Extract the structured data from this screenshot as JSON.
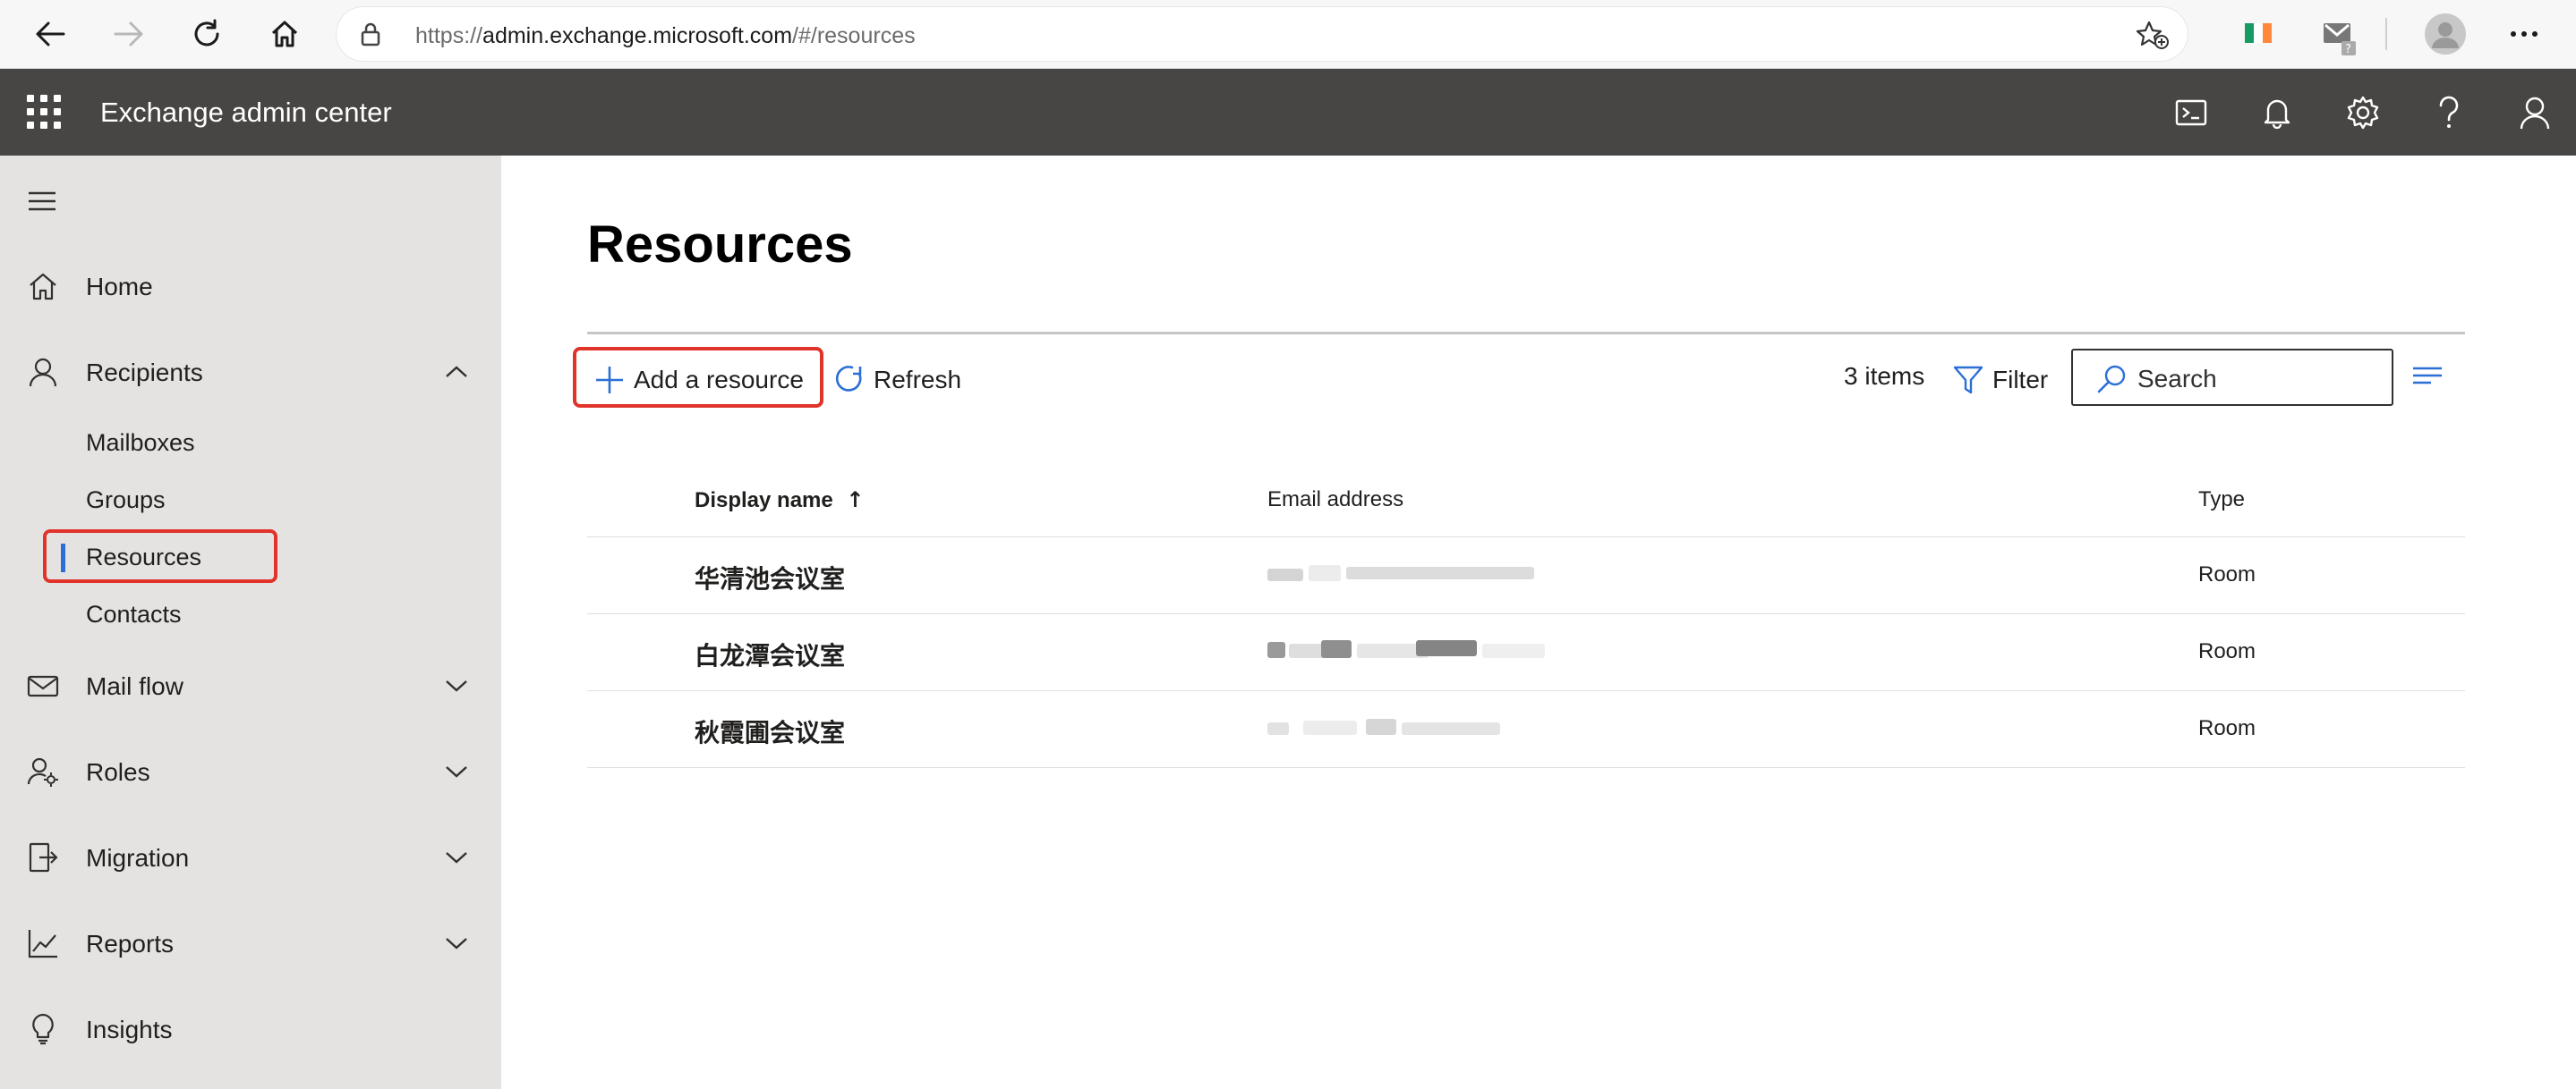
{
  "browser": {
    "url_prefix": "https://",
    "url_host": "admin.exchange.microsoft.com",
    "url_path": "/#/resources",
    "icons": [
      "back-icon",
      "forward-icon",
      "reload-icon",
      "home-icon",
      "lock-icon",
      "favorite-icon",
      "more-icon"
    ]
  },
  "header": {
    "app_title": "Exchange admin center",
    "icons": [
      "app-launcher-icon",
      "terminal-icon",
      "bell-icon",
      "gear-icon",
      "help-icon",
      "person-icon"
    ]
  },
  "sidebar": {
    "items": [
      {
        "label": "Home",
        "icon": "home-icon"
      },
      {
        "label": "Recipients",
        "icon": "person-icon",
        "expanded": true,
        "children": [
          "Mailboxes",
          "Groups",
          "Resources",
          "Contacts"
        ],
        "selected_child": "Resources"
      },
      {
        "label": "Mail flow",
        "icon": "mail-icon"
      },
      {
        "label": "Roles",
        "icon": "roles-icon"
      },
      {
        "label": "Migration",
        "icon": "migration-icon"
      },
      {
        "label": "Reports",
        "icon": "chart-icon"
      },
      {
        "label": "Insights",
        "icon": "lightbulb-icon"
      }
    ]
  },
  "main": {
    "title": "Resources",
    "add_label": "Add a resource",
    "refresh_label": "Refresh",
    "items_count": "3 items",
    "filter_label": "Filter",
    "search_placeholder": "Search",
    "columns": [
      "Display name",
      "Email address",
      "Type"
    ],
    "sort_indicator": "↑",
    "rows": [
      {
        "name": "华清池会议室",
        "email": "[redacted]",
        "type": "Room"
      },
      {
        "name": "白龙潭会议室",
        "email": "[redacted]",
        "type": "Room"
      },
      {
        "name": "秋霞圃会议室",
        "email": "[redacted]",
        "type": "Room"
      }
    ]
  },
  "colors": {
    "header_bg": "#484644",
    "sidebar_bg": "#e5e3e1",
    "accent": "#2b6fd6",
    "highlight": "#e0342a"
  }
}
